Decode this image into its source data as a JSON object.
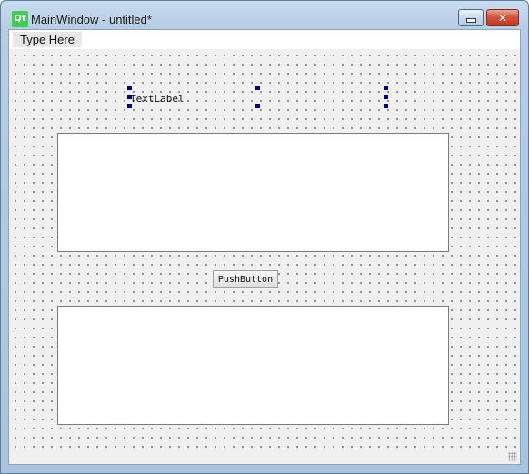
{
  "window": {
    "title": "MainWindow - untitled*",
    "logo_text": "Qt",
    "minimize_icon": "minimize-icon",
    "close_icon": "close-icon",
    "close_glyph": "✕"
  },
  "menubar": {
    "items": [
      {
        "label": "Type Here"
      }
    ]
  },
  "form": {
    "text_label": "TextLabel",
    "push_button": "PushButton",
    "selection_handle_color": "#000080"
  },
  "colors": {
    "qt_green": "#41cd52",
    "close_red": "#c1361f",
    "frame_blue": "#a9c3df"
  }
}
